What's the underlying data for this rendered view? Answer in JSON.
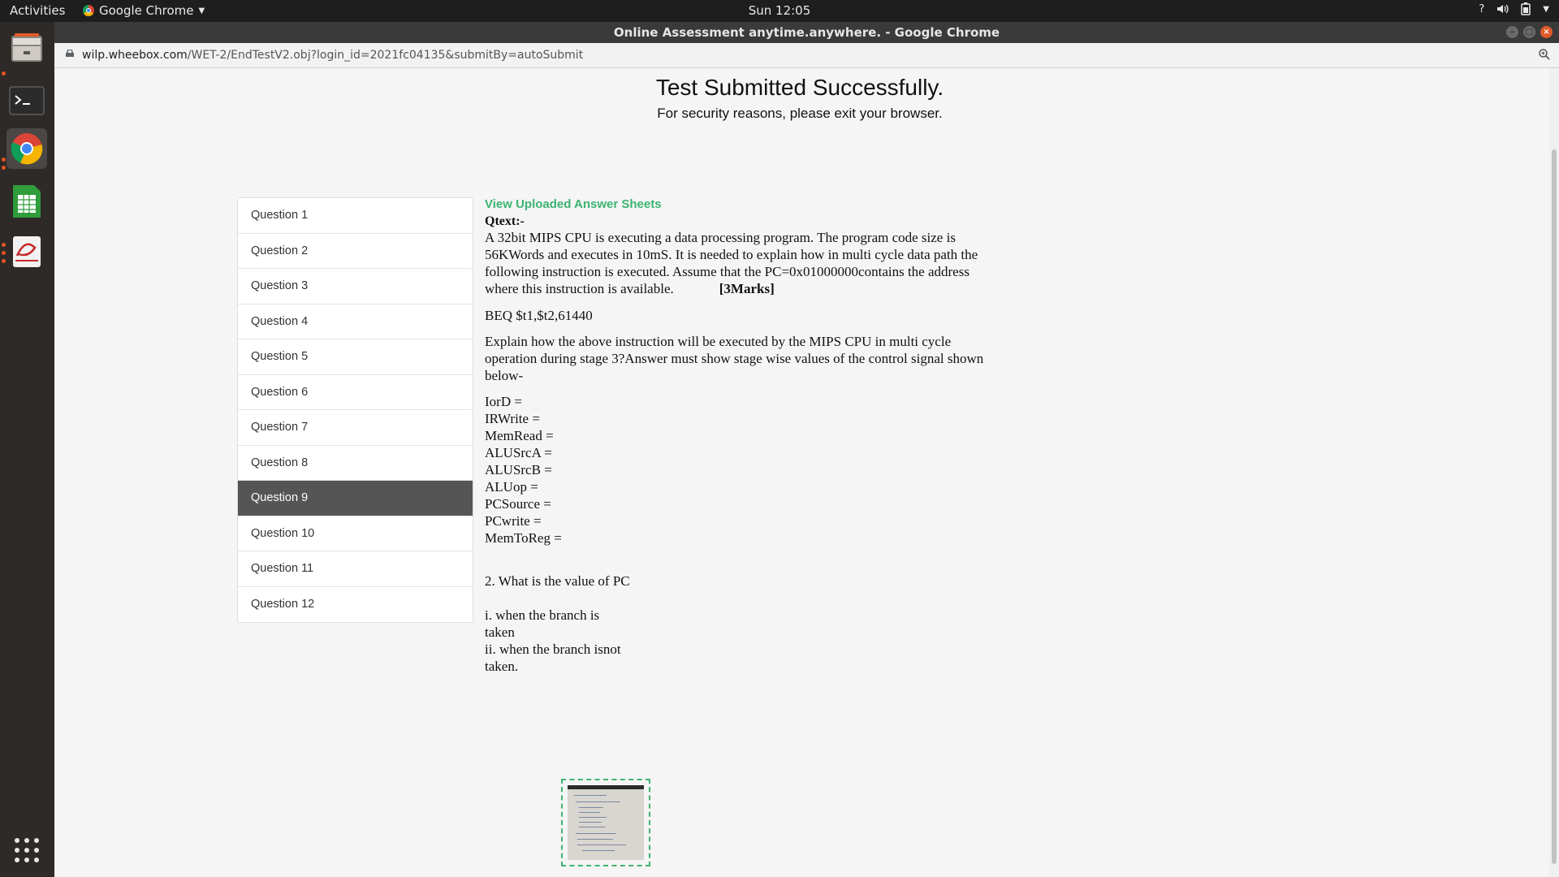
{
  "system": {
    "activities_label": "Activities",
    "app_name": "Google Chrome",
    "clock": "Sun 12:05",
    "tray_help": "?"
  },
  "window": {
    "title": "Online Assessment anytime.anywhere. - Google Chrome"
  },
  "address_bar": {
    "host": "wilp.wheebox.com",
    "path": "/WET-2/EndTestV2.obj?login_id=2021fc04135&submitBy=autoSubmit"
  },
  "page": {
    "heading": "Test Submitted Successfully.",
    "subheading": "For security reasons, please exit your browser.",
    "questions": [
      {
        "label": "Question 1"
      },
      {
        "label": "Question 2"
      },
      {
        "label": "Question 3"
      },
      {
        "label": "Question 4"
      },
      {
        "label": "Question 5"
      },
      {
        "label": "Question 6"
      },
      {
        "label": "Question 7"
      },
      {
        "label": "Question 8"
      },
      {
        "label": "Question 9"
      },
      {
        "label": "Question 10"
      },
      {
        "label": "Question 11"
      },
      {
        "label": "Question 12"
      }
    ],
    "active_question_index": 8,
    "view_sheets_link": "View Uploaded Answer Sheets",
    "qtext_label": "Qtext:-",
    "question_intro": "A 32bit MIPS CPU is executing a data processing program. The program code size is 56KWords and executes in 10mS. It is needed to explain how in multi cycle data path the following instruction is executed. Assume that the PC=0x01000000contains the address where this instruction is available.",
    "marks": "[3Marks]",
    "instruction": "BEQ  $t1,$t2,61440",
    "explain_text": "Explain how the above instruction will be executed by the MIPS CPU in multi cycle operation during stage 3?Answer must show stage wise values of the control signal shown below-",
    "signals": [
      "IorD =",
      "IRWrite =",
      "MemRead =",
      "ALUSrcA =",
      "ALUSrcB =",
      "ALUop =",
      "PCSource =",
      "PCwrite =",
      "MemToReg ="
    ],
    "q2_text": "2. What is the value of PC",
    "q2_i_line1": "i. when the branch is",
    "q2_i_line2": "taken",
    "q2_ii_line1": "ii. when the branch isnot",
    "q2_ii_line2": "taken."
  },
  "colors": {
    "accent_green": "#3cb371",
    "active_item_bg": "#555555",
    "ubuntu_orange": "#e95420"
  },
  "icons": {
    "dock": [
      "files-icon",
      "terminal-icon",
      "chrome-icon",
      "spreadsheet-icon",
      "document-viewer-icon",
      "app-grid-icon"
    ]
  }
}
